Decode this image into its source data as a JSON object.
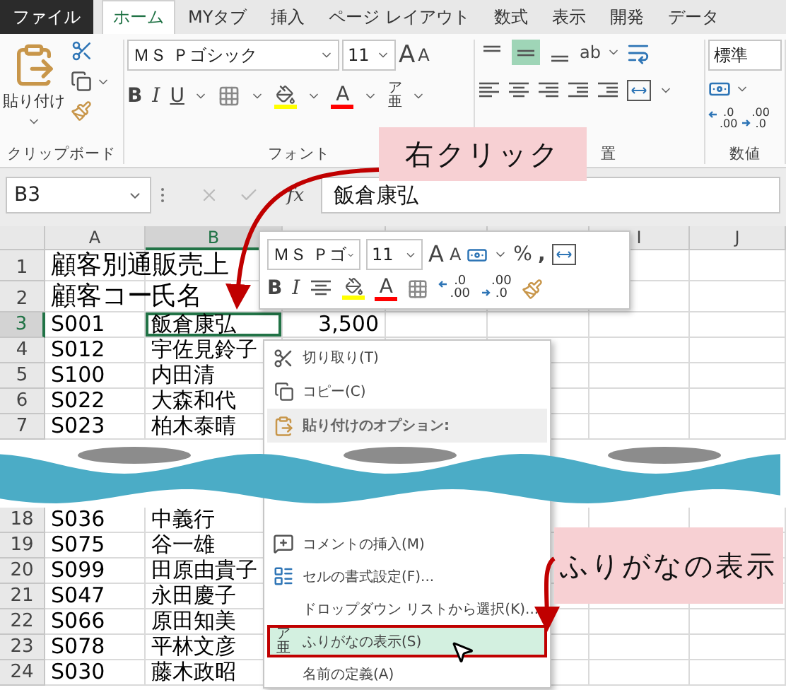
{
  "tabs": [
    {
      "label": "ファイル",
      "kind": "file",
      "selected": false
    },
    {
      "label": "ホーム",
      "kind": "tab",
      "selected": true
    },
    {
      "label": "MYタブ",
      "kind": "tab",
      "selected": false
    },
    {
      "label": "挿入",
      "kind": "tab",
      "selected": false
    },
    {
      "label": "ページ レイアウト",
      "kind": "tab",
      "selected": false
    },
    {
      "label": "数式",
      "kind": "tab",
      "selected": false
    },
    {
      "label": "表示",
      "kind": "tab",
      "selected": false
    },
    {
      "label": "開発",
      "kind": "tab",
      "selected": false
    },
    {
      "label": "データ",
      "kind": "tab",
      "selected": false
    }
  ],
  "ribbon": {
    "clipboard": {
      "paste": "貼り付け",
      "label": "クリップボード"
    },
    "font": {
      "name": "ＭＳ Ｐゴシック",
      "size": "11",
      "grow": "A",
      "shrink": "A",
      "bold": "B",
      "italic": "I",
      "underline": "U",
      "font_color": "A",
      "phonetic": {
        "top": "ア",
        "bottom": "亜"
      },
      "label": "フォント"
    },
    "alignment": {
      "vertical_align": [
        {
          "selected": false
        },
        {
          "selected": true
        },
        {
          "selected": false
        }
      ],
      "orientation": "ab",
      "label": "置"
    },
    "number": {
      "format": "標準",
      "increase_decimal": {
        "top": ".0",
        "bottom": ".00"
      },
      "decrease_decimal": {
        "top": ".00",
        "bottom": ".0"
      },
      "label": "数値"
    }
  },
  "formula_bar": {
    "name_box": "B3",
    "function": "fx",
    "formula": "飯倉康弘"
  },
  "sheet": {
    "columns": [
      {
        "label": "A",
        "selected": false
      },
      {
        "label": "B",
        "selected": true
      },
      {
        "selected": false
      },
      {
        "selected": false
      },
      {
        "selected": false
      },
      {
        "label": "I",
        "selected": false
      },
      {
        "label": "J",
        "selected": false
      }
    ],
    "rows_top": [
      {
        "label": "1",
        "kind": "large",
        "selected": false,
        "a": "顧客別通販売上"
      },
      {
        "label": "2",
        "kind": "large",
        "selected": false,
        "a": "顧客コー",
        "b": "氏名"
      },
      {
        "label": "3",
        "kind": "normal",
        "selected": true,
        "a": "S001",
        "b": "飯倉康弘",
        "c": "3,500"
      },
      {
        "label": "4",
        "kind": "normal",
        "selected": false,
        "a": "S012",
        "b": "宇佐見鈴子"
      },
      {
        "label": "5",
        "kind": "normal",
        "selected": false,
        "a": "S100",
        "b": "内田清"
      },
      {
        "label": "6",
        "kind": "normal",
        "selected": false,
        "a": "S022",
        "b": "大森和代"
      },
      {
        "label": "7",
        "kind": "normal",
        "selected": false,
        "a": "S023",
        "b": "柏木泰晴"
      }
    ],
    "rows_bottom": [
      {
        "label": "18",
        "kind": "normal",
        "selected": false,
        "a": "S036",
        "b": "中義行"
      },
      {
        "label": "19",
        "kind": "normal",
        "selected": false,
        "a": "S075",
        "b": "谷一雄"
      },
      {
        "label": "20",
        "kind": "normal",
        "selected": false,
        "a": "S099",
        "b": "田原由貴子"
      },
      {
        "label": "21",
        "kind": "normal",
        "selected": false,
        "a": "S047",
        "b": "永田慶子"
      },
      {
        "label": "22",
        "kind": "normal",
        "selected": false,
        "a": "S066",
        "b": "原田知美"
      },
      {
        "label": "23",
        "kind": "normal",
        "selected": false,
        "a": "S078",
        "b": "平林文彦"
      },
      {
        "label": "24",
        "kind": "normal",
        "selected": false,
        "a": "S030",
        "b": "藤木政昭"
      }
    ]
  },
  "mini_toolbar": {
    "font_name": "ＭＳ Ｐゴ",
    "font_size": "11",
    "grow": "A",
    "shrink": "A",
    "percent": "%",
    "comma": ",",
    "bold": "B",
    "italic": "I",
    "font_color": "A",
    "increase_decimal": {
      "top": ".0",
      "bottom": ".00"
    },
    "decrease_decimal": {
      "top": ".00",
      "bottom": ".0"
    }
  },
  "context_menu": {
    "items_top": [
      {
        "label": "切り取り(T)",
        "kind": "item",
        "selected": false
      },
      {
        "label": "コピー(C)",
        "kind": "item",
        "selected": false
      },
      {
        "label": "貼り付けのオプション:",
        "kind": "header",
        "selected": false
      }
    ],
    "items_bottom": [
      {
        "label": "コメントの挿入(M)",
        "kind": "item",
        "selected": false
      },
      {
        "label": "セルの書式設定(F)...",
        "kind": "item",
        "selected": false
      },
      {
        "label": "ドロップダウン リストから選択(K)...",
        "kind": "item",
        "selected": false
      },
      {
        "label": "ふりがなの表示(S)",
        "kind": "item",
        "selected": true,
        "phonetic": {
          "top": "ア",
          "bottom": "亜"
        }
      },
      {
        "label": "名前の定義(A)",
        "kind": "item",
        "selected": false
      }
    ]
  },
  "callouts": [
    {
      "text": "右クリック"
    },
    {
      "text": "ふりがなの表示"
    }
  ]
}
